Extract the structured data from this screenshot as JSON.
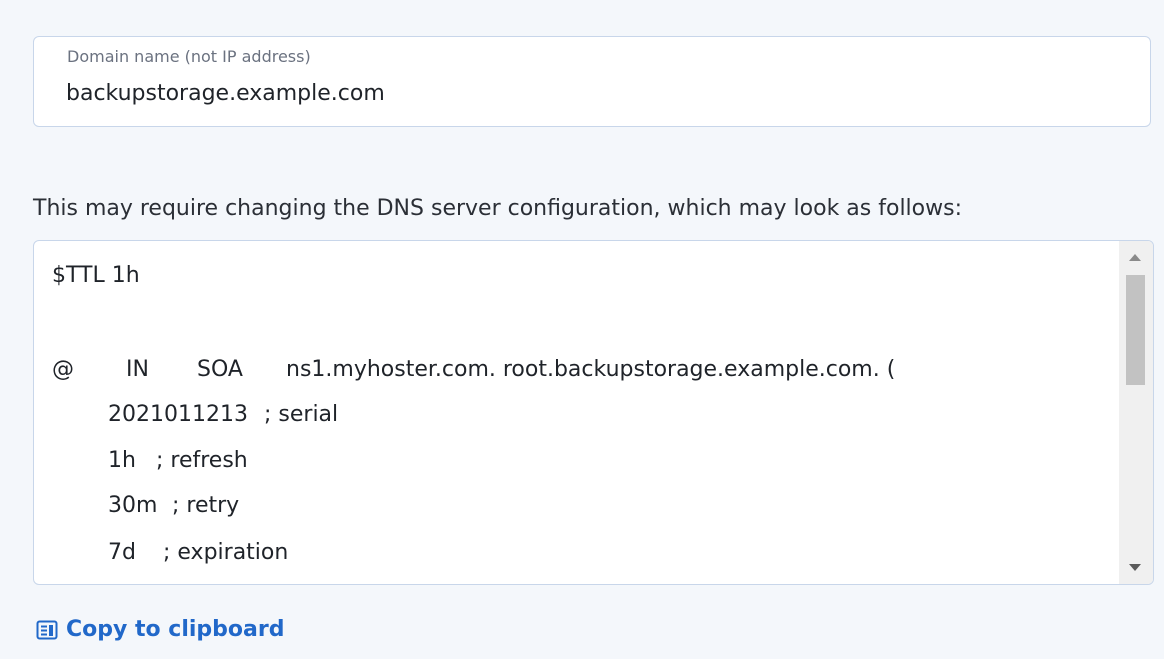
{
  "domain_field": {
    "label": "Domain name (not IP address)",
    "value": "backupstorage.example.com"
  },
  "dns_note": "This may require changing the DNS server configuration, which may look as follows:",
  "dns_config": {
    "ttl": "$TTL 1h",
    "soa": {
      "at": "@",
      "class": "IN",
      "type": "SOA",
      "record": "ns1.myhoster.com. root.backupstorage.example.com. ("
    },
    "serial": {
      "value": "2021011213",
      "comment": "; serial"
    },
    "refresh": {
      "value": "1h",
      "comment": "; refresh"
    },
    "retry": {
      "value": "30m",
      "comment": "; retry"
    },
    "expiration": {
      "value": "7d",
      "comment": "; expiration"
    }
  },
  "copy_link": {
    "label": "Copy to clipboard",
    "icon": "clipboard-icon",
    "color": "#2168c9"
  }
}
